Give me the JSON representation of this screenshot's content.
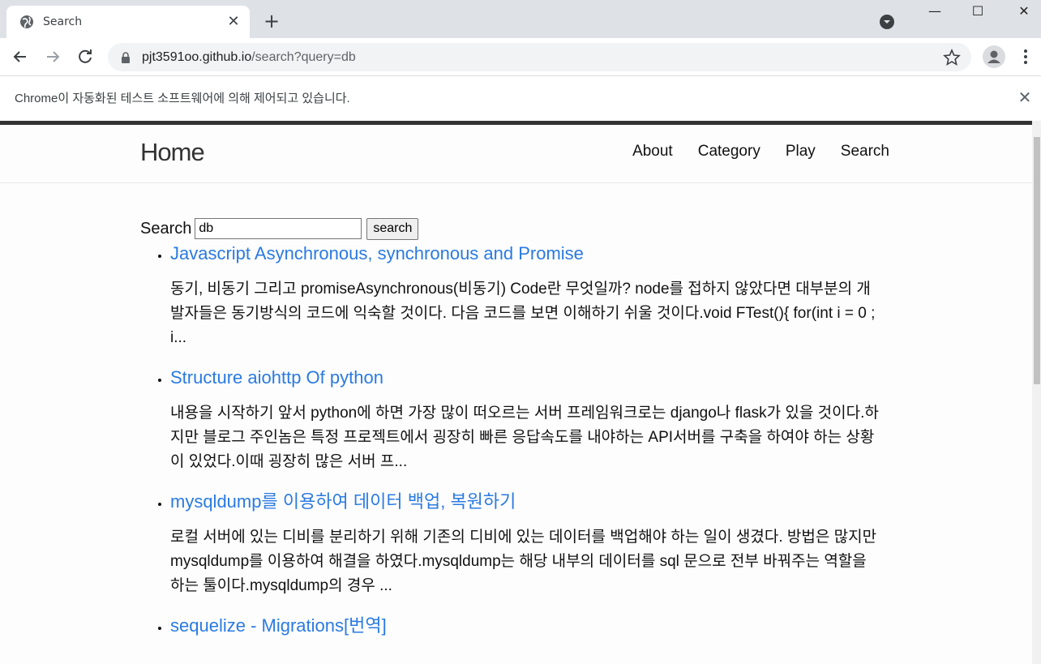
{
  "browser": {
    "tab_title": "Search",
    "url_host": "pjt3591oo.github.io",
    "url_path": "/search?query=db",
    "infobar_text": "Chrome이 자동화된 테스트 소프트웨어에 의해 제어되고 있습니다."
  },
  "site": {
    "title": "Home",
    "nav": [
      "About",
      "Category",
      "Play",
      "Search"
    ]
  },
  "search": {
    "label": "Search",
    "value": "db",
    "button_label": "search"
  },
  "results": [
    {
      "title": "Javascript Asynchronous, synchronous and Promise",
      "excerpt": "동기, 비동기 그리고 promiseAsynchronous(비동기) Code란 무엇일까? node를 접하지 않았다면 대부분의 개발자들은 동기방식의 코드에 익숙할 것이다. 다음 코드를 보면 이해하기 쉬울 것이다.void FTest(){ for(int i = 0 ; i..."
    },
    {
      "title": "Structure aiohttp Of python",
      "excerpt": "내용을 시작하기 앞서 python에 하면 가장 많이 떠오르는 서버 프레임워크로는 django나 flask가 있을 것이다.하지만 블로그 주인놈은 특정 프로젝트에서 굉장히 빠른 응답속도를 내야하는 API서버를 구축을 하여야 하는 상황이 있었다.이때 굉장히 많은 서버 프..."
    },
    {
      "title": "mysqldump를 이용하여 데이터 백업, 복원하기",
      "excerpt": "로컬 서버에 있는 디비를 분리하기 위해 기존의 디비에 있는 데이터를 백업해야 하는 일이 생겼다. 방법은 많지만 mysqldump를 이용하여 해결을 하였다.mysqldump는 해당 내부의 데이터를 sql 문으로 전부 바꿔주는 역할을 하는 툴이다.mysqldump의 경우 ..."
    },
    {
      "title": "sequelize - Migrations[번역]",
      "excerpt": ""
    }
  ]
}
